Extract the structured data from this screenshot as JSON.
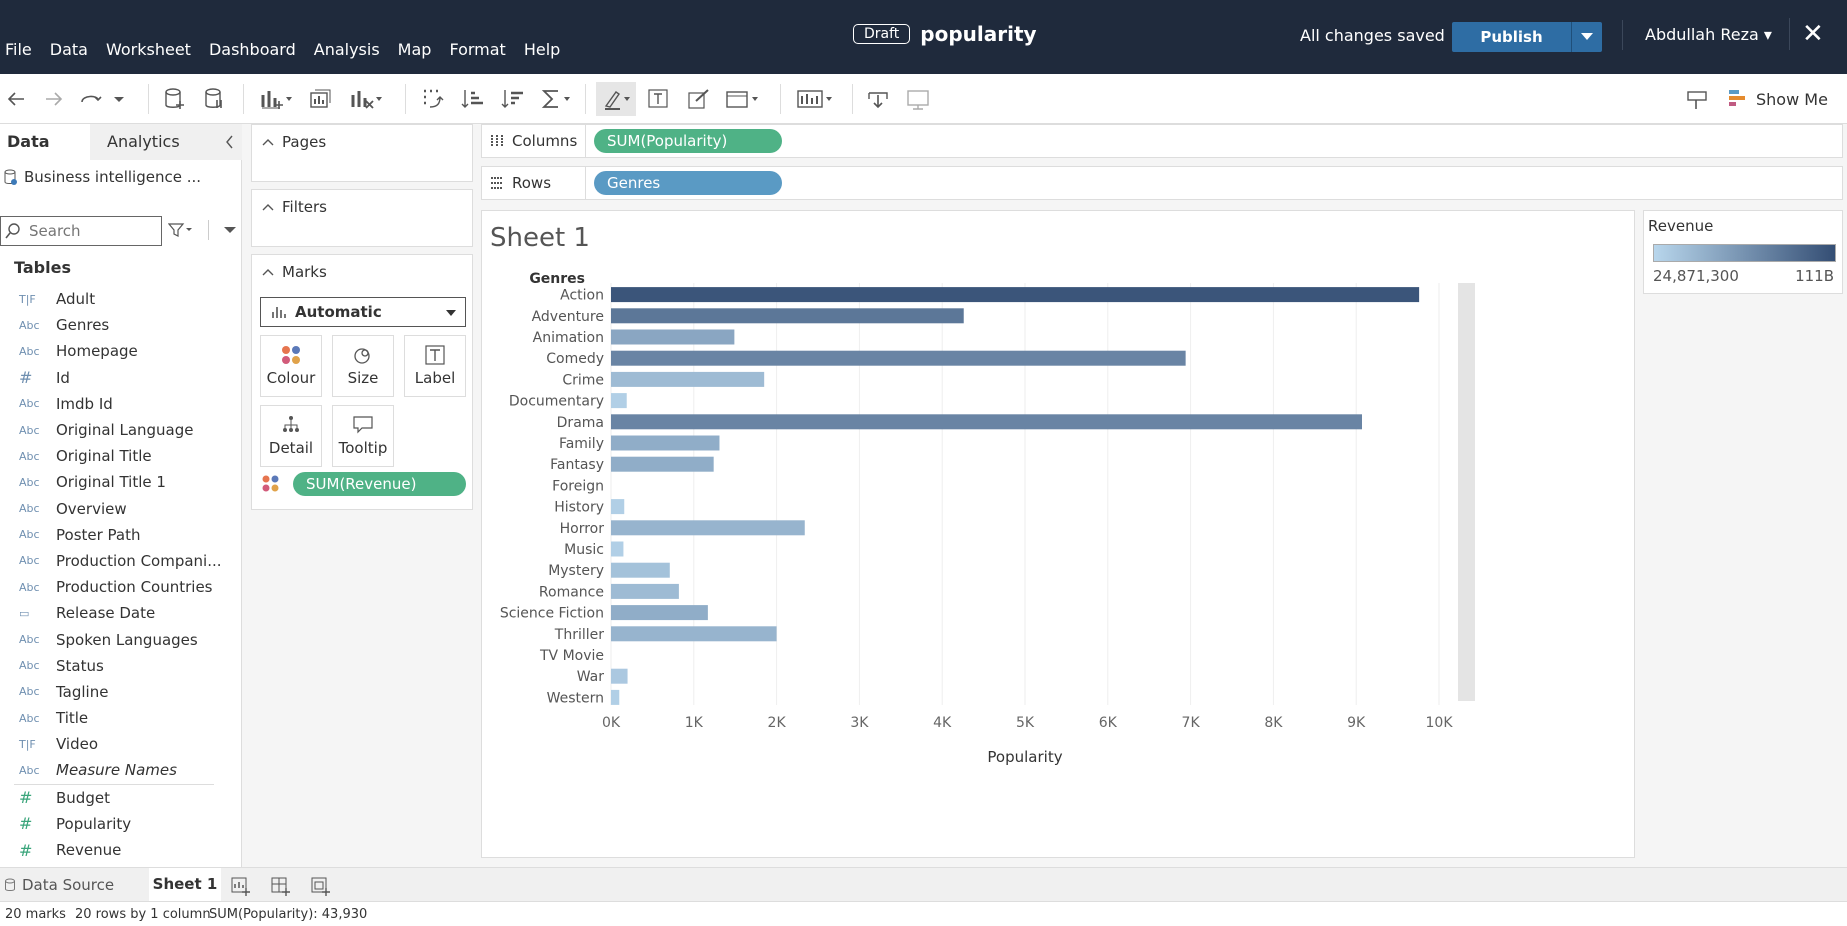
{
  "app": {
    "menu": [
      "File",
      "Data",
      "Worksheet",
      "Dashboard",
      "Analysis",
      "Map",
      "Format",
      "Help"
    ],
    "draft_badge": "Draft",
    "doc_title": "popularity",
    "save_status": "All changes saved",
    "publish_label": "Publish",
    "user_name": "Abdullah Reza",
    "show_me_label": "Show Me"
  },
  "data_pane": {
    "tab_data": "Data",
    "tab_analytics": "Analytics",
    "datasource": "Business intelligence ...",
    "search_placeholder": "Search",
    "tables_heading": "Tables",
    "dimensions": [
      {
        "type": "T|F",
        "name": "Adult"
      },
      {
        "type": "Abc",
        "name": "Genres"
      },
      {
        "type": "Abc",
        "name": "Homepage"
      },
      {
        "type": "#",
        "name": "Id"
      },
      {
        "type": "Abc",
        "name": "Imdb Id"
      },
      {
        "type": "Abc",
        "name": "Original Language"
      },
      {
        "type": "Abc",
        "name": "Original Title"
      },
      {
        "type": "Abc",
        "name": "Original Title 1"
      },
      {
        "type": "Abc",
        "name": "Overview"
      },
      {
        "type": "Abc",
        "name": "Poster Path"
      },
      {
        "type": "Abc",
        "name": "Production Compani..."
      },
      {
        "type": "Abc",
        "name": "Production Countries"
      },
      {
        "type": "cal",
        "name": "Release Date"
      },
      {
        "type": "Abc",
        "name": "Spoken Languages"
      },
      {
        "type": "Abc",
        "name": "Status"
      },
      {
        "type": "Abc",
        "name": "Tagline"
      },
      {
        "type": "Abc",
        "name": "Title"
      },
      {
        "type": "T|F",
        "name": "Video"
      },
      {
        "type": "Abc",
        "name": "Measure Names",
        "italic": true
      }
    ],
    "measures": [
      {
        "type": "#",
        "name": "Budget"
      },
      {
        "type": "#",
        "name": "Popularity"
      },
      {
        "type": "#",
        "name": "Revenue"
      }
    ]
  },
  "cards": {
    "pages": "Pages",
    "filters": "Filters",
    "marks": "Marks",
    "mark_type": "Automatic",
    "buttons": {
      "colour": "Colour",
      "size": "Size",
      "label": "Label",
      "detail": "Detail",
      "tooltip": "Tooltip"
    },
    "colour_pill": "SUM(Revenue)"
  },
  "shelves": {
    "columns_label": "Columns",
    "columns_pill": "SUM(Popularity)",
    "rows_label": "Rows",
    "rows_pill": "Genres"
  },
  "sheet": {
    "title": "Sheet 1"
  },
  "legend": {
    "title": "Revenue",
    "min": "24,871,300",
    "max": "111B",
    "color_low": "#b8d6ec",
    "color_high": "#344e74"
  },
  "tabs_bar": {
    "data_source": "Data Source",
    "sheet_tab": "Sheet 1"
  },
  "status": {
    "marks": "20 marks",
    "dims": "20 rows by 1 column",
    "sum": "SUM(Popularity): 43,930"
  },
  "chart_data": {
    "type": "bar",
    "orientation": "horizontal",
    "row_header": "Genres",
    "xlabel": "Popularity",
    "xlim": [
      0,
      10000
    ],
    "xticks": [
      "0K",
      "1K",
      "2K",
      "3K",
      "4K",
      "5K",
      "6K",
      "7K",
      "8K",
      "9K",
      "10K"
    ],
    "categories": [
      "Action",
      "Adventure",
      "Animation",
      "Comedy",
      "Crime",
      "Documentary",
      "Drama",
      "Family",
      "Fantasy",
      "Foreign",
      "History",
      "Horror",
      "Music",
      "Mystery",
      "Romance",
      "Science Fiction",
      "Thriller",
      "TV Movie",
      "War",
      "Western"
    ],
    "values": [
      9760,
      4260,
      1490,
      6940,
      1850,
      190,
      9070,
      1310,
      1240,
      0,
      160,
      2340,
      150,
      710,
      820,
      1170,
      2000,
      0,
      200,
      100
    ],
    "color_values": [
      0.95,
      0.7,
      0.35,
      0.6,
      0.2,
      0.05,
      0.6,
      0.3,
      0.3,
      0.0,
      0.05,
      0.25,
      0.05,
      0.15,
      0.2,
      0.3,
      0.25,
      0.0,
      0.1,
      0.05
    ],
    "grid": true
  }
}
